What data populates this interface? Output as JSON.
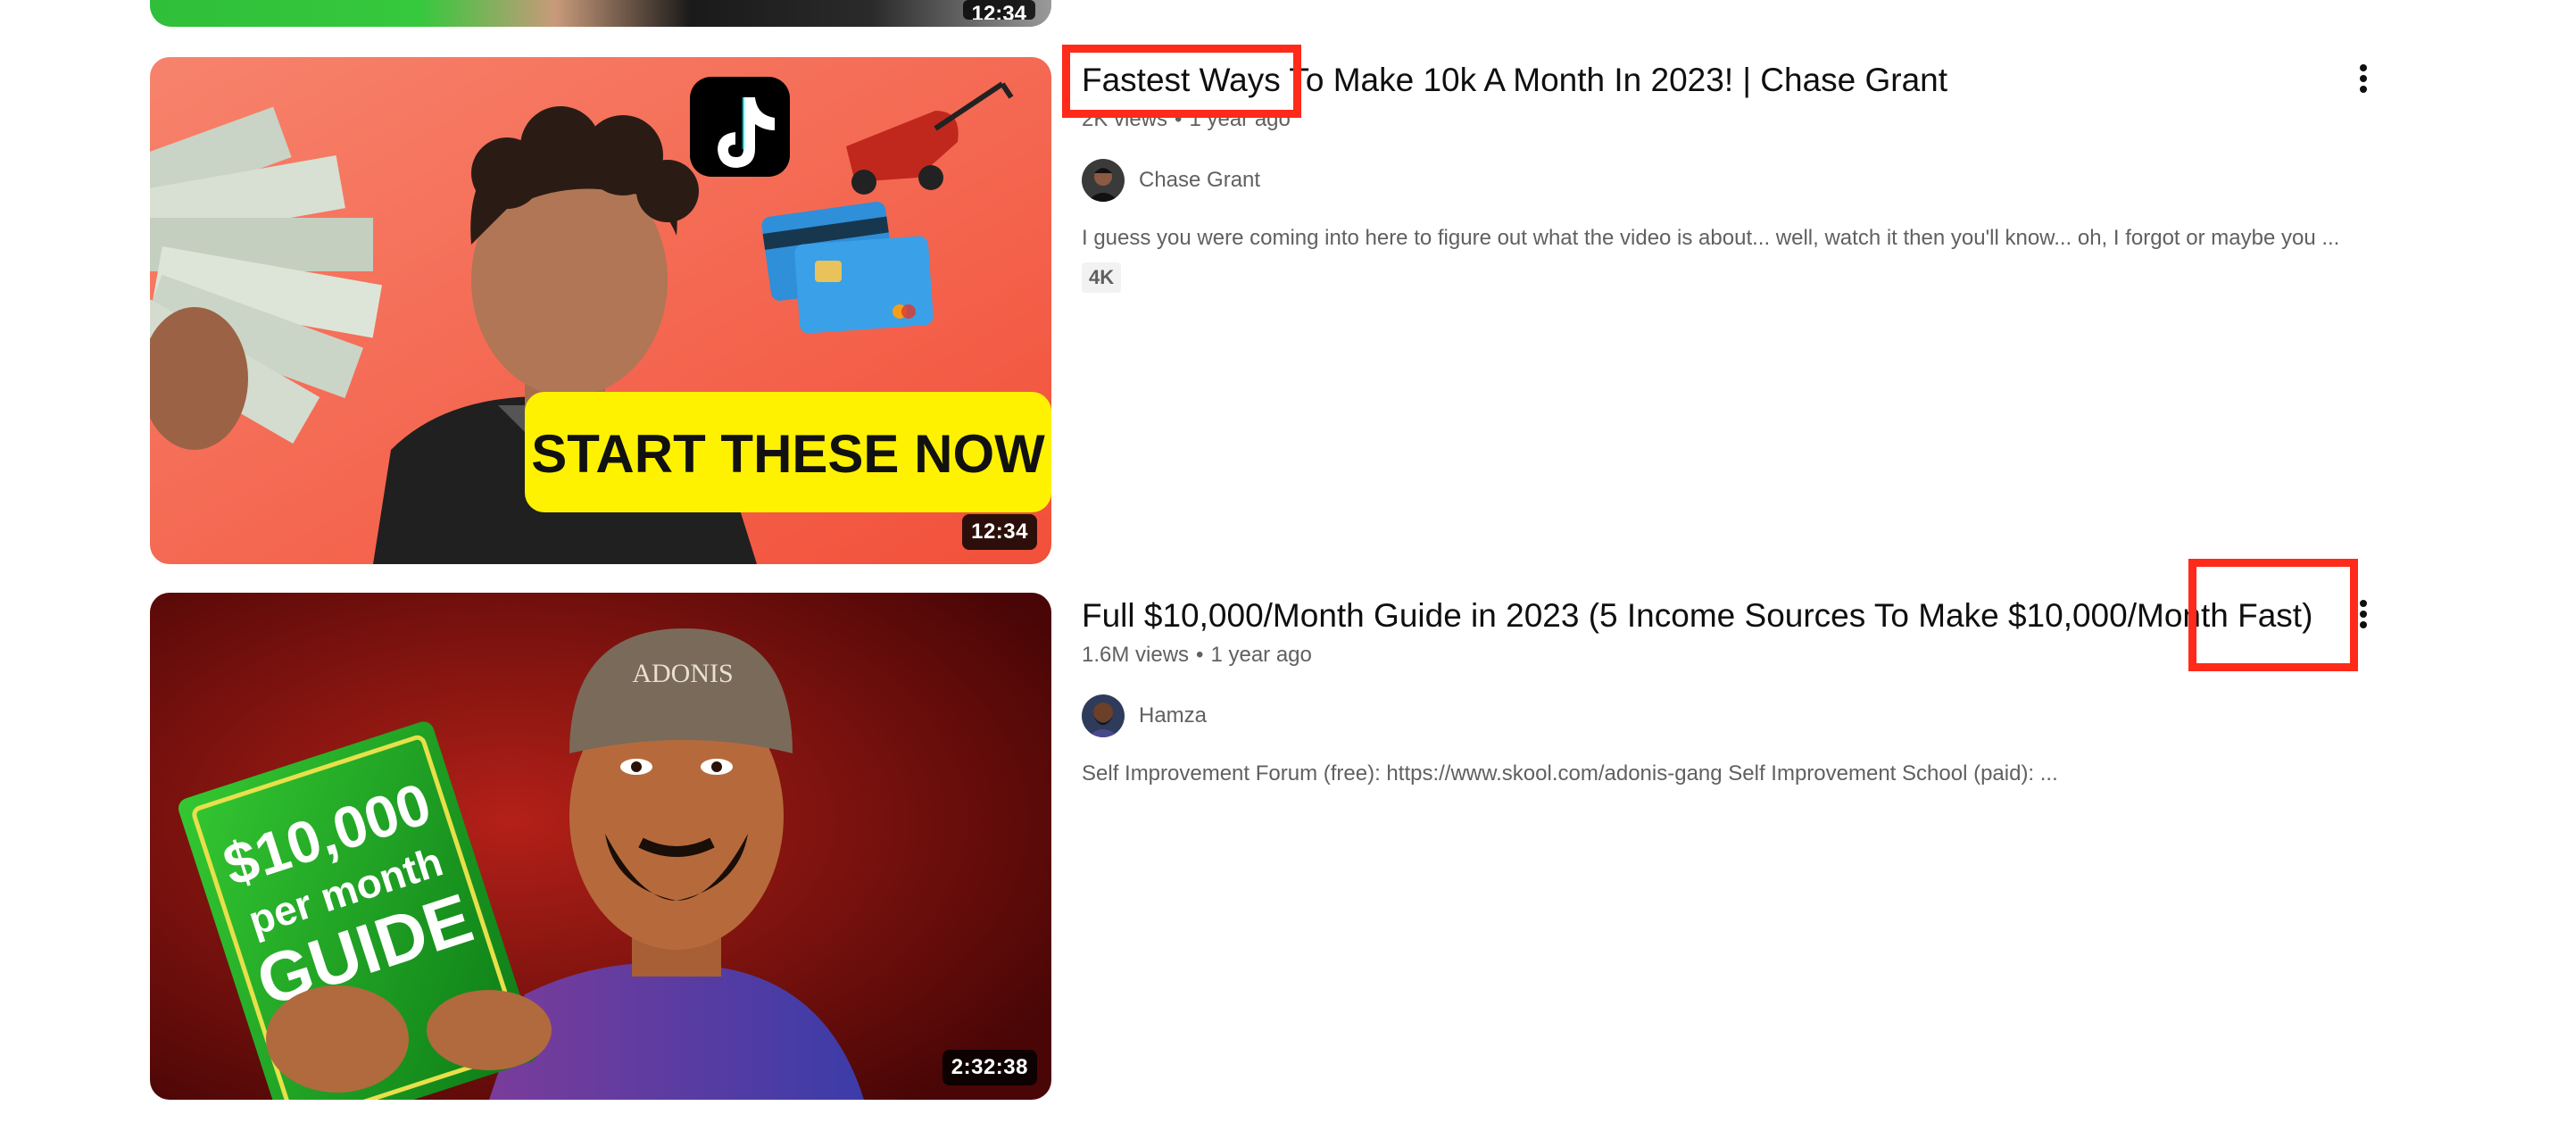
{
  "previous_video": {
    "duration": "12:34"
  },
  "videos": [
    {
      "title": "Fastest Ways To Make 10k A Month In 2023! | Chase Grant",
      "views": "2K views",
      "age": "1 year ago",
      "channel": "Chase Grant",
      "description": "I guess you were coming into here to figure out what the video is about... well, watch it then you'll know... oh, I forgot or maybe you ...",
      "badge": "4K",
      "duration": "12:34",
      "thumbnail_text": "START THESE NOW",
      "thumbnail_bg": "#f4644e",
      "icons": [
        "tiktok-icon",
        "lawnmower-icon",
        "credit-card-icon",
        "cash-fan-icon"
      ]
    },
    {
      "title": "Full $10,000/Month Guide in 2023 (5 Income Sources To Make $10,000/Month Fast)",
      "views": "1.6M views",
      "age": "1 year ago",
      "channel": "Hamza",
      "description": "Self Improvement Forum (free): https://www.skool.com/adonis-gang Self Improvement School (paid): ...",
      "duration": "2:32:38",
      "thumbnail_book_line1": "$10,000",
      "thumbnail_book_line2": "per month",
      "thumbnail_book_line3": "GUIDE",
      "thumbnail_cap_text": "ADONIS",
      "thumbnail_bg": "#8a1414"
    }
  ],
  "highlights": {
    "color": "#ff2a1a"
  },
  "meta_separator": "•"
}
